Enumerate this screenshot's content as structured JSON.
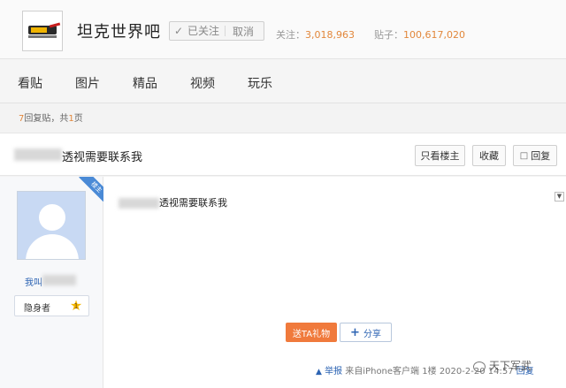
{
  "header": {
    "forum_name": "坦克世界吧",
    "follow_check": "✓",
    "followed_label": "已关注",
    "cancel_label": "取消",
    "followers_label": "关注：",
    "followers_count": "3,018,963",
    "posts_label": "贴子：",
    "posts_count": "100,617,020"
  },
  "nav": {
    "items": [
      {
        "label": "看贴"
      },
      {
        "label": "图片"
      },
      {
        "label": "精品"
      },
      {
        "label": "视频"
      },
      {
        "label": "玩乐"
      }
    ]
  },
  "thread_info": {
    "reply_count": "7",
    "reply_text": "回复贴，共",
    "page_count": "1",
    "page_suffix": "页"
  },
  "thread": {
    "title": "透视需要联系我",
    "only_op_label": "只看楼主",
    "favorite_label": "收藏",
    "reply_label": "回复"
  },
  "post": {
    "op_badge": "楼主",
    "author_name": "我叫",
    "level_title": "隐身者",
    "level_number": "1",
    "content": "透视需要联系我",
    "gift_label": "送TA礼物",
    "share_label": "分享",
    "report_icon": "▲",
    "report_label": "举报",
    "source": "来自iPhone客户端",
    "floor": "1楼",
    "timestamp": "2020-2-20 14:57",
    "reply_link": "回复"
  },
  "watermark": {
    "text": "天下军武"
  },
  "colors": {
    "accent": "#e2873b",
    "link": "#2d64b3",
    "gift": "#f07a3c",
    "op_badge": "#4a8ad6"
  }
}
